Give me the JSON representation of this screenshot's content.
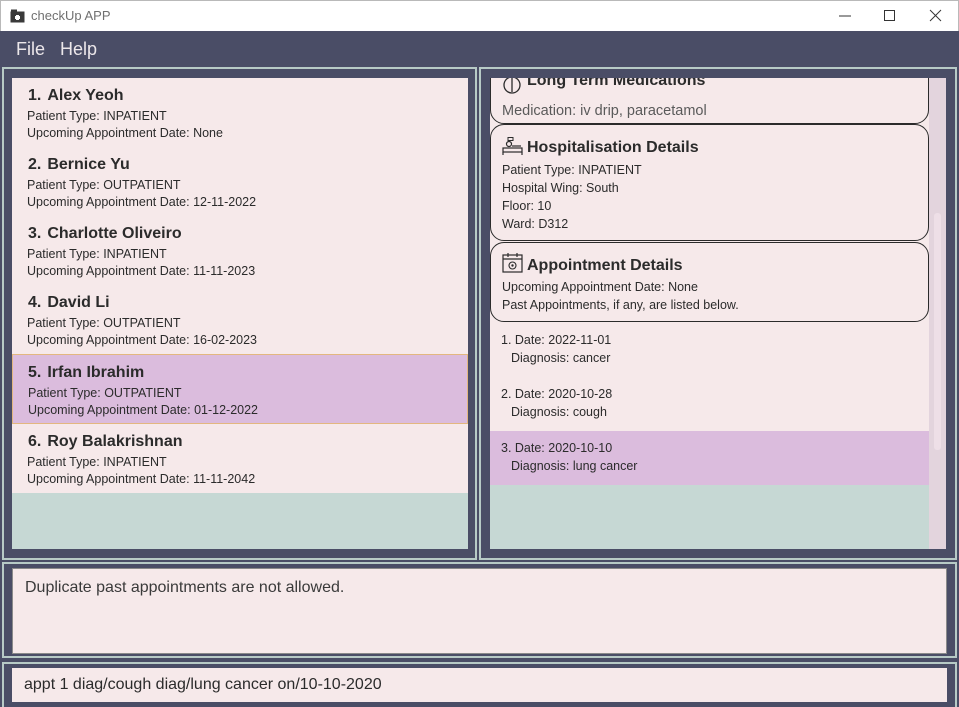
{
  "window": {
    "title": "checkUp APP"
  },
  "menu": {
    "items": [
      "File",
      "Help"
    ]
  },
  "patients": [
    {
      "index": "1.",
      "name": "Alex Yeoh",
      "type": "Patient Type: INPATIENT",
      "appointment": "Upcoming Appointment Date: None"
    },
    {
      "index": "2.",
      "name": "Bernice Yu",
      "type": "Patient Type: OUTPATIENT",
      "appointment": "Upcoming Appointment Date: 12-11-2022"
    },
    {
      "index": "3.",
      "name": "Charlotte Oliveiro",
      "type": "Patient Type: INPATIENT",
      "appointment": "Upcoming Appointment Date: 11-11-2023"
    },
    {
      "index": "4.",
      "name": "David Li",
      "type": "Patient Type: OUTPATIENT",
      "appointment": "Upcoming Appointment Date: 16-02-2023"
    },
    {
      "index": "5.",
      "name": "Irfan Ibrahim",
      "type": "Patient Type: OUTPATIENT",
      "appointment": "Upcoming Appointment Date: 01-12-2022"
    },
    {
      "index": "6.",
      "name": "Roy Balakrishnan",
      "type": "Patient Type: INPATIENT",
      "appointment": "Upcoming Appointment Date: 11-11-2042"
    }
  ],
  "selected_patient_index": 4,
  "details": {
    "medications": {
      "title": "Long Term Medications",
      "line": "Medication: iv drip, paracetamol"
    },
    "hospitalisation": {
      "title": "Hospitalisation Details",
      "patient_type": "Patient Type: INPATIENT",
      "wing": "Hospital Wing: South",
      "floor": "Floor: 10",
      "ward": "Ward: D312"
    },
    "appointment": {
      "title": "Appointment Details",
      "upcoming": "Upcoming Appointment Date: None",
      "note": "Past Appointments, if any, are listed below."
    },
    "past_appointments": [
      {
        "date": "1. Date: 2022-11-01",
        "diagnosis": "Diagnosis: cancer"
      },
      {
        "date": "2. Date: 2020-10-28",
        "diagnosis": "Diagnosis: cough"
      },
      {
        "date": "3. Date: 2020-10-10",
        "diagnosis": "Diagnosis: lung cancer"
      }
    ],
    "selected_past_index": 2
  },
  "result": {
    "message": "Duplicate past appointments are not allowed."
  },
  "command": {
    "value": "appt 1 diag/cough diag/lung cancer on/10-10-2020"
  },
  "colors": {
    "background": "#4a4d66",
    "card": "#f6e9ea",
    "selected": "#dbbcdd",
    "empty_area": "#c6d8d4"
  }
}
